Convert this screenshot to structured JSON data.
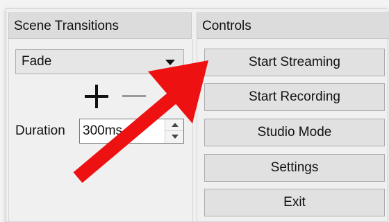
{
  "scene_transitions": {
    "title": "Scene Transitions",
    "transition_select": {
      "value": "Fade"
    },
    "add_label": "+",
    "remove_label": "−",
    "duration": {
      "label": "Duration",
      "value": "300ms"
    }
  },
  "controls": {
    "title": "Controls",
    "buttons": [
      "Start Streaming",
      "Start Recording",
      "Studio Mode",
      "Settings",
      "Exit"
    ]
  },
  "colors": {
    "annotation_arrow": "#ee1111"
  }
}
